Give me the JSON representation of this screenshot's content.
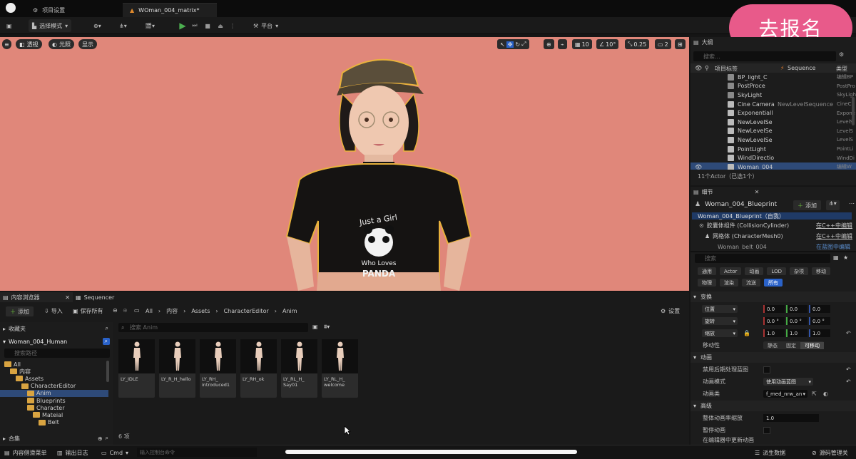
{
  "titlebar": {
    "tabs": [
      {
        "label": "项目设置"
      },
      {
        "label": "WOman_004_matrix*"
      }
    ]
  },
  "toolbar": {
    "select_mode": "选择模式",
    "platform": "平台"
  },
  "signup_button": "去报名",
  "viewport": {
    "left_buttons": [
      "透视",
      "光照",
      "显示"
    ],
    "right_values": [
      "10",
      "10°",
      "0.25",
      "2"
    ]
  },
  "outliner": {
    "title": "大纲",
    "search_placeholder": "搜索...",
    "headers": {
      "label": "项目标签",
      "sequence": "Sequence",
      "type": "类型"
    },
    "rows": [
      {
        "name": "BP_light_C",
        "seq": "",
        "type": "编辑BP",
        "icon": "#8a8a8a"
      },
      {
        "name": "PostProce",
        "seq": "",
        "type": "PostPro",
        "icon": "#8a8a8a"
      },
      {
        "name": "SkyLight",
        "seq": "",
        "type": "SkyLigh",
        "icon": "#8a8a8a"
      },
      {
        "name": "Cine Camera",
        "seq": "NewLevelSequence",
        "type": "CineCa",
        "icon": "#bbbbbb"
      },
      {
        "name": "Exponentiall",
        "seq": "",
        "type": "Expone",
        "icon": "#bbbbbb"
      },
      {
        "name": "NewLevelSe",
        "seq": "",
        "type": "LevelS",
        "icon": "#bbbbbb"
      },
      {
        "name": "NewLevelSe",
        "seq": "",
        "type": "LevelS",
        "icon": "#bbbbbb"
      },
      {
        "name": "NewLevelSe",
        "seq": "",
        "type": "LevelS",
        "icon": "#bbbbbb"
      },
      {
        "name": "PointLight",
        "seq": "",
        "type": "PointLi",
        "icon": "#bbbbbb"
      },
      {
        "name": "WindDirectio",
        "seq": "",
        "type": "WindDi",
        "icon": "#bbbbbb"
      },
      {
        "name": "Woman_004",
        "seq": "",
        "type": "编辑W",
        "icon": "#bbbbbb"
      }
    ],
    "footer": "11个Actor（已选1个）"
  },
  "details": {
    "title": "细节",
    "object_name": "Woman_004_Blueprint",
    "add_label": "添加",
    "components": [
      {
        "name": "Woman_004_Blueprint（自我）",
        "link": ""
      },
      {
        "name": "胶囊体组件 (CollisionCylinder)",
        "link": "在C++中编辑"
      },
      {
        "name": "网格体 (CharacterMesh0)",
        "link": "在C++中编辑"
      },
      {
        "name": "Woman_belt_004",
        "link": "在蓝图中编辑"
      }
    ],
    "search_placeholder": "搜索",
    "filters_row1": [
      "通用",
      "Actor",
      "动画",
      "LOD",
      "杂项",
      "移动"
    ],
    "filters_row2": [
      "物理",
      "渲染",
      "流送",
      "所有"
    ],
    "transform": {
      "section": "变换",
      "location_label": "位置",
      "location": [
        "0.0",
        "0.0",
        "0.0"
      ],
      "rotation_label": "旋转",
      "rotation": [
        "0.0 °",
        "0.0 °",
        "0.0 °"
      ],
      "scale_label": "缩放",
      "scale": [
        "1.0",
        "1.0",
        "1.0"
      ],
      "mobility_label": "移动性",
      "mobility_options": [
        "静态",
        "固定",
        "可移动"
      ]
    },
    "animation": {
      "section": "动画",
      "disable_post_label": "禁用后期处理蓝图",
      "mode_label": "动画模式",
      "mode_value": "使用动画蓝图",
      "class_label": "动画类",
      "class_value": "f_med_nrw_an"
    },
    "advanced": {
      "section": "高级",
      "rate_label": "整体动画率缩放",
      "rate_value": "1.0",
      "pause_label": "暂停动画",
      "editor_label": "在编辑器中更新动画"
    }
  },
  "content_browser": {
    "tabs": [
      "内容浏览器",
      "Sequencer"
    ],
    "add_label": "添加",
    "import_label": "导入",
    "save_all_label": "保存所有",
    "breadcrumb": [
      "All",
      "内容",
      "Assets",
      "CharacterEditor",
      "Anim"
    ],
    "settings_label": "设置",
    "favorites_label": "收藏夹",
    "project_label": "Woman_004_Human",
    "tree_search_placeholder": "搜索路径",
    "tree": [
      {
        "label": "All",
        "indent": 0
      },
      {
        "label": "内容",
        "indent": 1
      },
      {
        "label": "Assets",
        "indent": 2
      },
      {
        "label": "CharacterEditor",
        "indent": 3
      },
      {
        "label": "Anim",
        "indent": 4
      },
      {
        "label": "Blueprints",
        "indent": 4
      },
      {
        "label": "Character",
        "indent": 4
      },
      {
        "label": "Mateial",
        "indent": 5
      },
      {
        "label": "Belt",
        "indent": 6
      }
    ],
    "collections_label": "合集",
    "search_placeholder": "搜索 Anim",
    "assets": [
      {
        "label": "LY_IDLE"
      },
      {
        "label": "LY_R_H_hello"
      },
      {
        "label": "LY_RH_ introduced1"
      },
      {
        "label": "LY_RH_ok"
      },
      {
        "label": "LY_RL_H_ Say01"
      },
      {
        "label": "LY_RL_H_ welcome"
      }
    ],
    "item_count": "6 项"
  },
  "statusbar": {
    "drawer": "内容侧滑菜单",
    "output_log": "输出日志",
    "cmd": "Cmd",
    "console_placeholder": "输入控制台命令",
    "derived_data": "派生数据",
    "source_control": "源码管理关"
  }
}
